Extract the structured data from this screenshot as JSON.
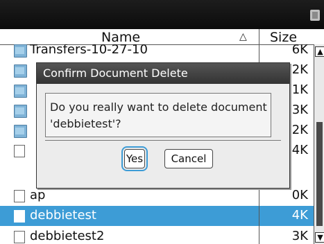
{
  "header": {
    "name_label": "Name",
    "size_label": "Size",
    "sort_icon": "△"
  },
  "files": [
    {
      "name": "Transfers-10-27-10",
      "size": "6K",
      "type": "folder"
    },
    {
      "name": "",
      "size": "2K",
      "type": "folder"
    },
    {
      "name": "",
      "size": "1K",
      "type": "folder"
    },
    {
      "name": "",
      "size": "3K",
      "type": "folder"
    },
    {
      "name": "",
      "size": "2K",
      "type": "folder"
    },
    {
      "name": "",
      "size": "4K",
      "type": "doc"
    },
    {
      "name": "ap",
      "size": "0K",
      "type": "doc"
    },
    {
      "name": "debbietest",
      "size": "4K",
      "type": "doc",
      "selected": true
    },
    {
      "name": "debbietest2",
      "size": "3K",
      "type": "doc"
    }
  ],
  "dialog": {
    "title": "Confirm Document Delete",
    "message_line1": "Do you really want to delete document",
    "message_line2": "'debbietest'?",
    "yes_label": "Yes",
    "cancel_label": "Cancel"
  },
  "colors": {
    "selection": "#3d9cd6",
    "title_bar": "#333333",
    "top_bar": "#111111"
  },
  "icons": {
    "battery": "battery-icon",
    "folder": "folder-icon",
    "document": "document-icon",
    "scroll_up": "arrow-up-icon",
    "scroll_down": "arrow-down-icon"
  }
}
